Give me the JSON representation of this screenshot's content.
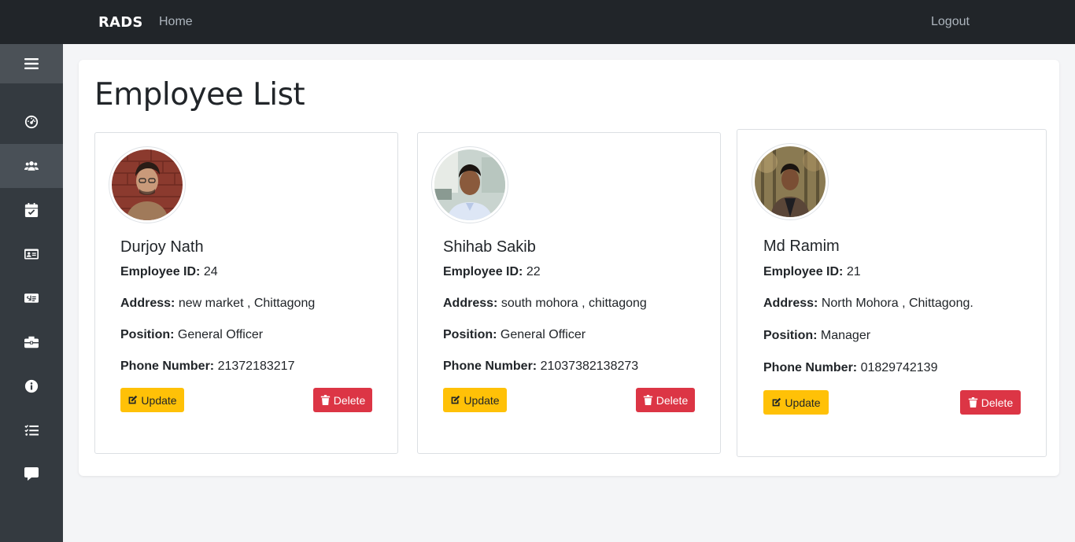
{
  "navbar": {
    "brand": "RADS",
    "home_label": "Home",
    "logout_label": "Logout"
  },
  "sidebar": {
    "items": [
      {
        "icon": "dashboard-icon"
      },
      {
        "icon": "users-icon",
        "active": true
      },
      {
        "icon": "calendar-check-icon"
      },
      {
        "icon": "id-card-icon"
      },
      {
        "icon": "money-bill-icon"
      },
      {
        "icon": "briefcase-icon"
      },
      {
        "icon": "info-icon"
      },
      {
        "icon": "task-list-icon"
      },
      {
        "icon": "comment-icon"
      }
    ]
  },
  "page": {
    "title": "Employee List"
  },
  "labels": {
    "employee_id": "Employee ID:",
    "address": "Address:",
    "position": "Position:",
    "phone": "Phone Number:",
    "update": "Update",
    "delete": "Delete"
  },
  "employees": [
    {
      "name": "Durjoy Nath",
      "id": "24",
      "address": "new market , Chittagong",
      "position": "General Officer",
      "phone": "21372183217"
    },
    {
      "name": "Shihab Sakib",
      "id": "22",
      "address": "south mohora , chittagong",
      "position": "General Officer",
      "phone": "21037382138273"
    },
    {
      "name": "Md Ramim",
      "id": "21",
      "address": "North Mohora , Chittagong.",
      "position": "Manager",
      "phone": "01829742139"
    }
  ],
  "colors": {
    "update": "#ffc107",
    "delete": "#dc3545",
    "navbar": "#212529",
    "sidebar": "#343a40"
  }
}
